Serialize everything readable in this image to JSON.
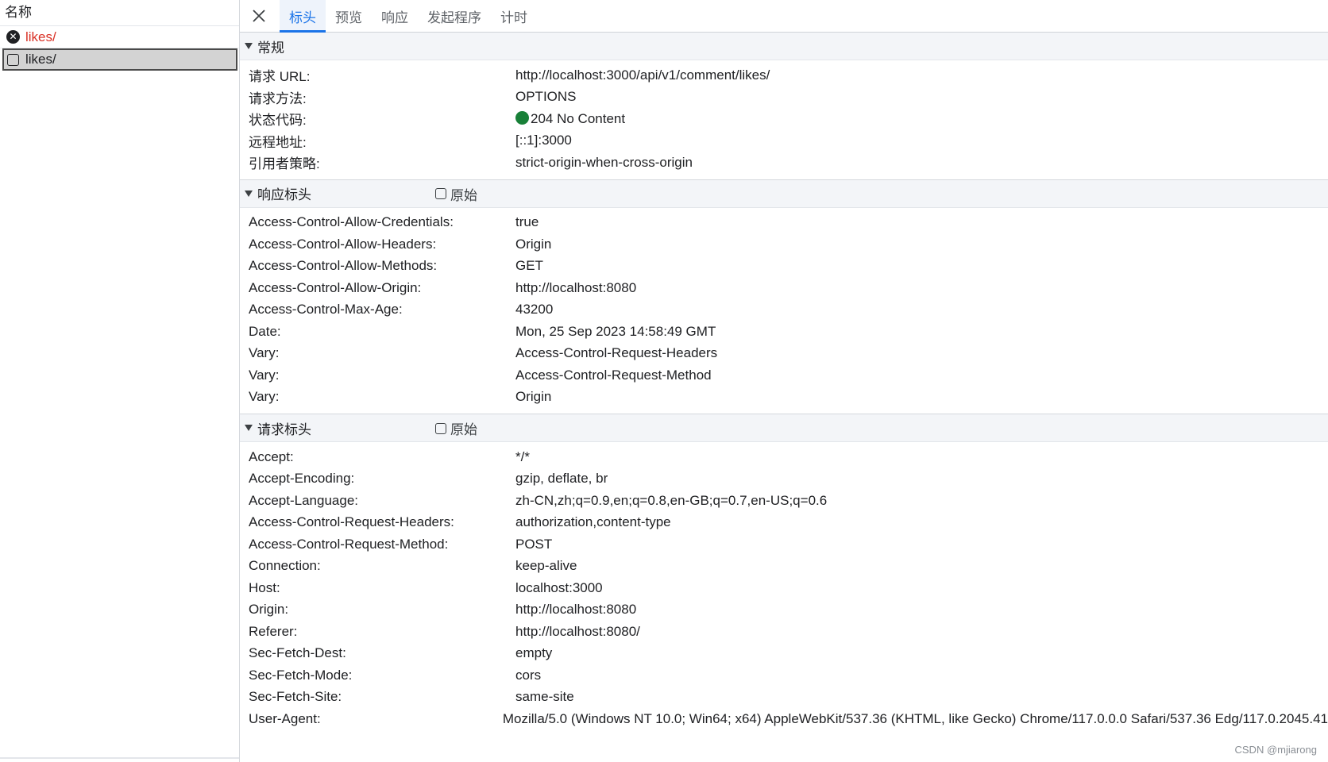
{
  "left_panel": {
    "header": "名称",
    "requests": [
      {
        "name": "likes/",
        "state": "error"
      },
      {
        "name": "likes/",
        "state": "selected"
      }
    ]
  },
  "tabs": [
    {
      "label": "标头",
      "active": true
    },
    {
      "label": "预览",
      "active": false
    },
    {
      "label": "响应",
      "active": false
    },
    {
      "label": "发起程序",
      "active": false
    },
    {
      "label": "计时",
      "active": false
    }
  ],
  "general": {
    "title": "常规",
    "rows": [
      {
        "key": "请求 URL:",
        "value": "http://localhost:3000/api/v1/comment/likes/"
      },
      {
        "key": "请求方法:",
        "value": "OPTIONS"
      },
      {
        "key": "状态代码:",
        "value": "204 No Content"
      },
      {
        "key": "远程地址:",
        "value": "[::1]:3000"
      },
      {
        "key": "引用者策略:",
        "value": "strict-origin-when-cross-origin"
      }
    ]
  },
  "response_headers": {
    "title": "响应标头",
    "raw_label": "原始",
    "rows": [
      {
        "key": "Access-Control-Allow-Credentials:",
        "value": "true"
      },
      {
        "key": "Access-Control-Allow-Headers:",
        "value": "Origin"
      },
      {
        "key": "Access-Control-Allow-Methods:",
        "value": "GET"
      },
      {
        "key": "Access-Control-Allow-Origin:",
        "value": "http://localhost:8080"
      },
      {
        "key": "Access-Control-Max-Age:",
        "value": "43200"
      },
      {
        "key": "Date:",
        "value": "Mon, 25 Sep 2023 14:58:49 GMT"
      },
      {
        "key": "Vary:",
        "value": "Access-Control-Request-Headers"
      },
      {
        "key": "Vary:",
        "value": "Access-Control-Request-Method"
      },
      {
        "key": "Vary:",
        "value": "Origin"
      }
    ]
  },
  "request_headers": {
    "title": "请求标头",
    "raw_label": "原始",
    "rows": [
      {
        "key": "Accept:",
        "value": "*/*"
      },
      {
        "key": "Accept-Encoding:",
        "value": "gzip, deflate, br"
      },
      {
        "key": "Accept-Language:",
        "value": "zh-CN,zh;q=0.9,en;q=0.8,en-GB;q=0.7,en-US;q=0.6"
      },
      {
        "key": "Access-Control-Request-Headers:",
        "value": "authorization,content-type"
      },
      {
        "key": "Access-Control-Request-Method:",
        "value": "POST"
      },
      {
        "key": "Connection:",
        "value": "keep-alive"
      },
      {
        "key": "Host:",
        "value": "localhost:3000"
      },
      {
        "key": "Origin:",
        "value": "http://localhost:8080"
      },
      {
        "key": "Referer:",
        "value": "http://localhost:8080/"
      },
      {
        "key": "Sec-Fetch-Dest:",
        "value": "empty"
      },
      {
        "key": "Sec-Fetch-Mode:",
        "value": "cors"
      },
      {
        "key": "Sec-Fetch-Site:",
        "value": "same-site"
      },
      {
        "key": "User-Agent:",
        "value": "Mozilla/5.0 (Windows NT 10.0; Win64; x64) AppleWebKit/537.36 (KHTML, like Gecko) Chrome/117.0.0.0 Safari/537.36 Edg/117.0.2045.41"
      }
    ]
  },
  "colors": {
    "accent": "#1a73e8",
    "error_text": "#d93025",
    "status_ok": "#188038"
  },
  "watermark": "CSDN @mjiarong"
}
